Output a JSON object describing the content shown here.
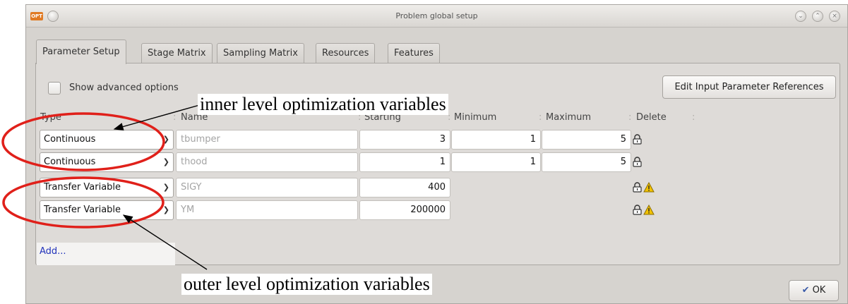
{
  "window": {
    "title": "Problem global setup",
    "app_icon": "OPT"
  },
  "tabs": [
    {
      "label": "Parameter Setup",
      "active": true
    },
    {
      "label": "Stage Matrix",
      "active": false
    },
    {
      "label": "Sampling Matrix",
      "active": false
    },
    {
      "label": "Resources",
      "active": false
    },
    {
      "label": "Features",
      "active": false
    }
  ],
  "options": {
    "show_advanced_label": "Show advanced options",
    "show_advanced_checked": false,
    "edit_refs_label": "Edit Input Parameter References"
  },
  "table": {
    "headers": {
      "type": "Type",
      "name": "Name",
      "starting": "Starting",
      "minimum": "Minimum",
      "maximum": "Maximum",
      "delete": "Delete"
    },
    "rows": [
      {
        "type": "Continuous",
        "name": "tbumper",
        "starting": "3",
        "minimum": "1",
        "maximum": "5",
        "icons": [
          "lock-icon"
        ]
      },
      {
        "type": "Continuous",
        "name": "thood",
        "starting": "1",
        "minimum": "1",
        "maximum": "5",
        "icons": [
          "lock-icon"
        ]
      },
      {
        "type": "Transfer Variable",
        "name": "SIGY",
        "starting": "400",
        "minimum": "",
        "maximum": "",
        "icons": [
          "lock-icon",
          "warning-icon"
        ]
      },
      {
        "type": "Transfer Variable",
        "name": "YM",
        "starting": "200000",
        "minimum": "",
        "maximum": "",
        "icons": [
          "lock-icon",
          "warning-icon"
        ]
      }
    ],
    "add_label": "Add..."
  },
  "buttons": {
    "ok_label": "OK"
  },
  "annotations": {
    "inner": "inner level optimization variables",
    "outer": "outer level optimization variables"
  },
  "colors": {
    "annotation_ellipse": "#e0201a",
    "link": "#2233bb",
    "warning": "#f2c200"
  }
}
